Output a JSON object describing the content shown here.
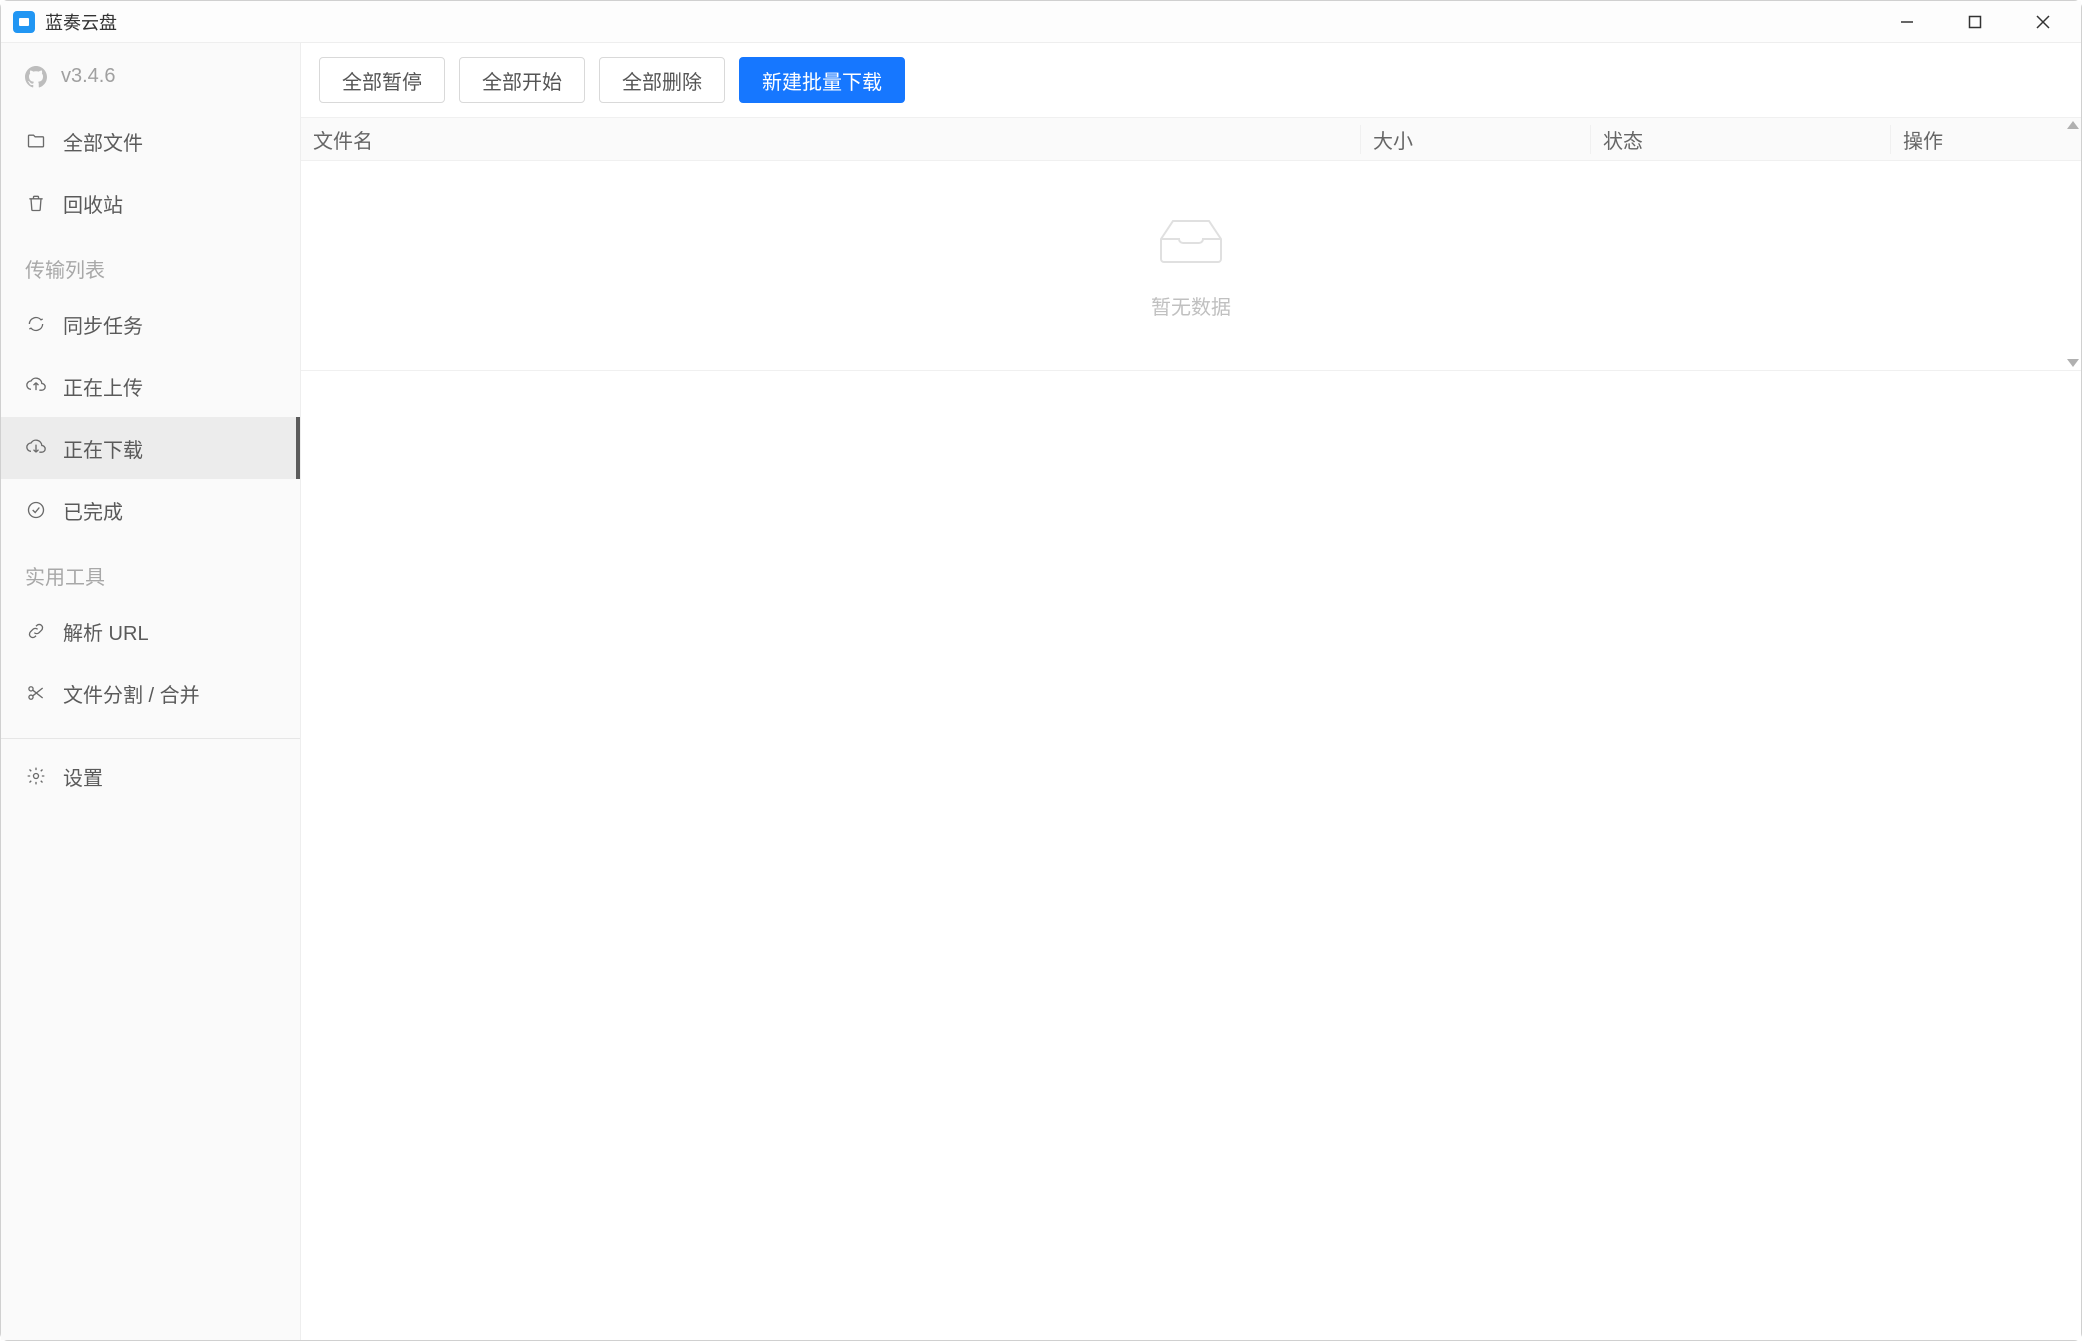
{
  "window": {
    "title": "蓝奏云盘"
  },
  "sidebar": {
    "version": "v3.4.6",
    "items": [
      {
        "id": "all-files",
        "label": "全部文件",
        "icon": "folder-icon",
        "active": false
      },
      {
        "id": "recycle-bin",
        "label": "回收站",
        "icon": "trash-icon",
        "active": false
      }
    ],
    "section_transfer_title": "传输列表",
    "transfer_items": [
      {
        "id": "sync-tasks",
        "label": "同步任务",
        "icon": "sync-icon",
        "active": false
      },
      {
        "id": "uploading",
        "label": "正在上传",
        "icon": "upload-icon",
        "active": false
      },
      {
        "id": "downloading",
        "label": "正在下载",
        "icon": "download-cloud-icon",
        "active": true
      },
      {
        "id": "completed",
        "label": "已完成",
        "icon": "check-circle-icon",
        "active": false
      }
    ],
    "section_tools_title": "实用工具",
    "tool_items": [
      {
        "id": "parse-url",
        "label": "解析 URL",
        "icon": "link-icon",
        "active": false
      },
      {
        "id": "split-merge",
        "label": "文件分割 / 合并",
        "icon": "scissors-icon",
        "active": false
      }
    ],
    "settings_label": "设置"
  },
  "toolbar": {
    "pause_all": "全部暂停",
    "start_all": "全部开始",
    "delete_all": "全部删除",
    "new_batch_download": "新建批量下载"
  },
  "table": {
    "columns": {
      "filename": "文件名",
      "size": "大小",
      "status": "状态",
      "action": "操作"
    },
    "empty_text": "暂无数据"
  }
}
